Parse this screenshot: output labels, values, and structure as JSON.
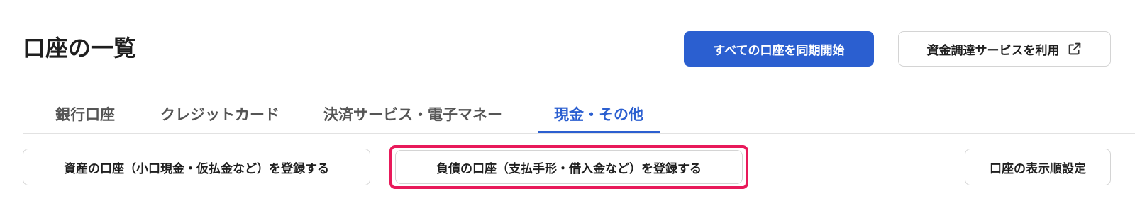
{
  "header": {
    "title": "口座の一覧",
    "sync_all_label": "すべての口座を同期開始",
    "funding_service_label": "資金調達サービスを利用",
    "funding_service_icon": "external-link-icon"
  },
  "tabs": [
    {
      "label": "銀行口座",
      "active": false
    },
    {
      "label": "クレジットカード",
      "active": false
    },
    {
      "label": "決済サービス・電子マネー",
      "active": false
    },
    {
      "label": "現金・その他",
      "active": true
    }
  ],
  "actions": {
    "register_asset_label": "資産の口座（小口現金・仮払金など）を登録する",
    "register_liability_label": "負債の口座（支払手形・借入金など）を登録する",
    "display_order_label": "口座の表示順設定"
  },
  "colors": {
    "primary": "#2b5fd0",
    "highlight": "#e8195a"
  }
}
